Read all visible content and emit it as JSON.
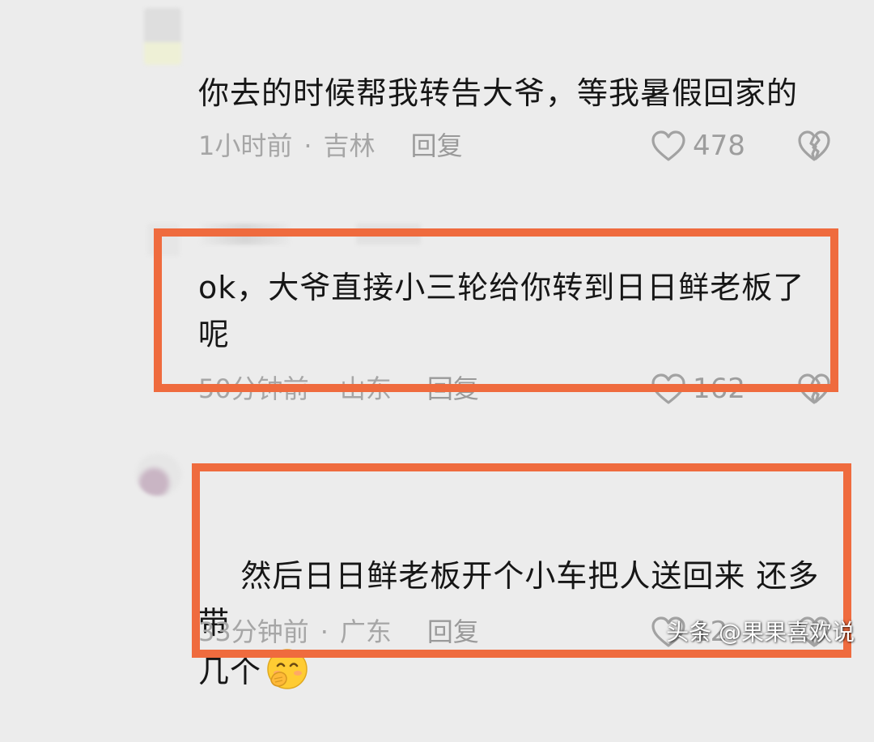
{
  "comments": [
    {
      "text": "你去的时候帮我转告大爷，等我暑假回家的",
      "time": "1小时前",
      "separator": "·",
      "location": "吉林",
      "reply_label": "回复",
      "likes": "478"
    },
    {
      "text": "ok，大爷直接小三轮给你转到日日鲜老板了\n呢",
      "time": "50分钟前",
      "separator": "·",
      "location": "山东",
      "reply_label": "回复",
      "likes": "162"
    },
    {
      "text": "然后日日鲜老板开个小车把人送回来 还多带\n几个",
      "time": "33分钟前",
      "separator": "·",
      "location": "广东",
      "reply_label": "回复",
      "likes": "12"
    }
  ],
  "watermark": "头条 @果果喜欢说",
  "colors": {
    "background": "#ececec",
    "highlight": "#ef6b3e",
    "meta_text": "#a6a6a6"
  },
  "icons": {
    "like": "heart-outline-icon",
    "dislike": "broken-heart-icon",
    "emoji": "blush-face-emoji"
  }
}
